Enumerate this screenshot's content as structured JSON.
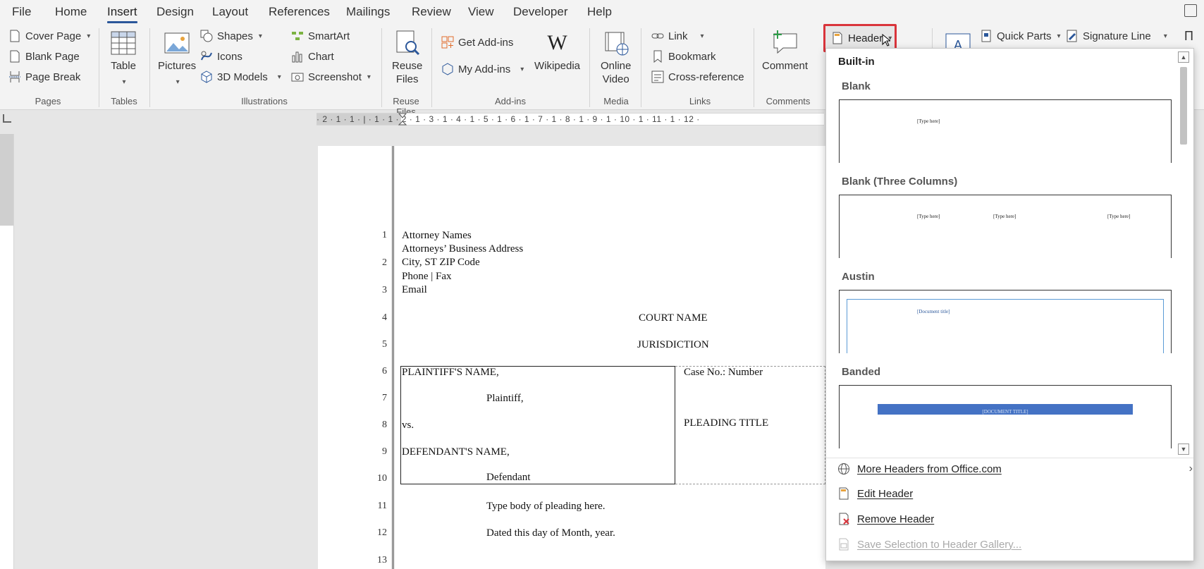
{
  "menubar": {
    "tabs": [
      "File",
      "Home",
      "Insert",
      "Design",
      "Layout",
      "References",
      "Mailings",
      "Review",
      "View",
      "Developer",
      "Help"
    ],
    "active_tab": "Insert"
  },
  "ribbon": {
    "pages": {
      "cover_page": "Cover Page",
      "blank_page": "Blank Page",
      "page_break": "Page Break",
      "group": "Pages"
    },
    "tables": {
      "table": "Table",
      "group": "Tables"
    },
    "illustrations": {
      "pictures": "Pictures",
      "shapes": "Shapes",
      "icons": "Icons",
      "models": "3D Models",
      "smartart": "SmartArt",
      "chart": "Chart",
      "screenshot": "Screenshot",
      "group": "Illustrations"
    },
    "reuse": {
      "line1": "Reuse",
      "line2": "Files",
      "group": "Reuse Files"
    },
    "addins": {
      "get": "Get Add-ins",
      "my": "My Add-ins",
      "wikipedia": "Wikipedia",
      "group": "Add-ins"
    },
    "media": {
      "line1": "Online",
      "line2": "Video",
      "group": "Media"
    },
    "links": {
      "link": "Link",
      "bookmark": "Bookmark",
      "crossref": "Cross-reference",
      "group": "Links"
    },
    "comments": {
      "comment": "Comment",
      "group": "Comments"
    },
    "header": {
      "label": "Header"
    },
    "text": {
      "quick_parts": "Quick Parts",
      "signature_line": "Signature Line"
    }
  },
  "ruler": {
    "h": "· 2 · 1 · 1 · | · 1 · 1 · 2 · 1 · 3 · 1 · 4 · 1 · 5 · 1 · 6 · 1 · 7 · 1 · 8 · 1 · 9 · 1 · 10 · 1 · 11 · 1 · 12 ·"
  },
  "document": {
    "line_numbers": [
      "1",
      "2",
      "3",
      "4",
      "5",
      "6",
      "7",
      "8",
      "9",
      "10",
      "11",
      "12",
      "13"
    ],
    "attorney_names": "Attorney Names",
    "business_address": "Attorneys’ Business Address",
    "city_line": "City, ST ZIP Code",
    "phone_fax": "Phone | Fax",
    "email": "Email",
    "court_name": "COURT NAME",
    "jurisdiction": "JURISDICTION",
    "plaintiff_name": "PLAINTIFF'S NAME,",
    "plaintiff": "Plaintiff,",
    "vs": "vs.",
    "defendant_name": "DEFENDANT'S NAME,",
    "defendant": "Defendant",
    "case_no": "Case No.: Number",
    "pleading_title": "PLEADING TITLE",
    "body": "Type body of pleading here.",
    "dated": "Dated this day of Month, year."
  },
  "dropdown": {
    "title": "Built-in",
    "sections": [
      "Blank",
      "Blank (Three Columns)",
      "Austin",
      "Banded"
    ],
    "placeholders": {
      "type_here": "[Type here]",
      "doc_title": "[Document title]",
      "doc_title_caps": "[DOCUMENT TITLE]"
    },
    "more": "More Headers from Office.com",
    "edit": "Edit Header",
    "remove": "Remove Header",
    "save": "Save Selection to Header Gallery..."
  },
  "colors": {
    "accent": "#2b579a",
    "highlight": "#d9343b",
    "banded": "#4472c4",
    "austin_border": "#5b9bd5"
  }
}
